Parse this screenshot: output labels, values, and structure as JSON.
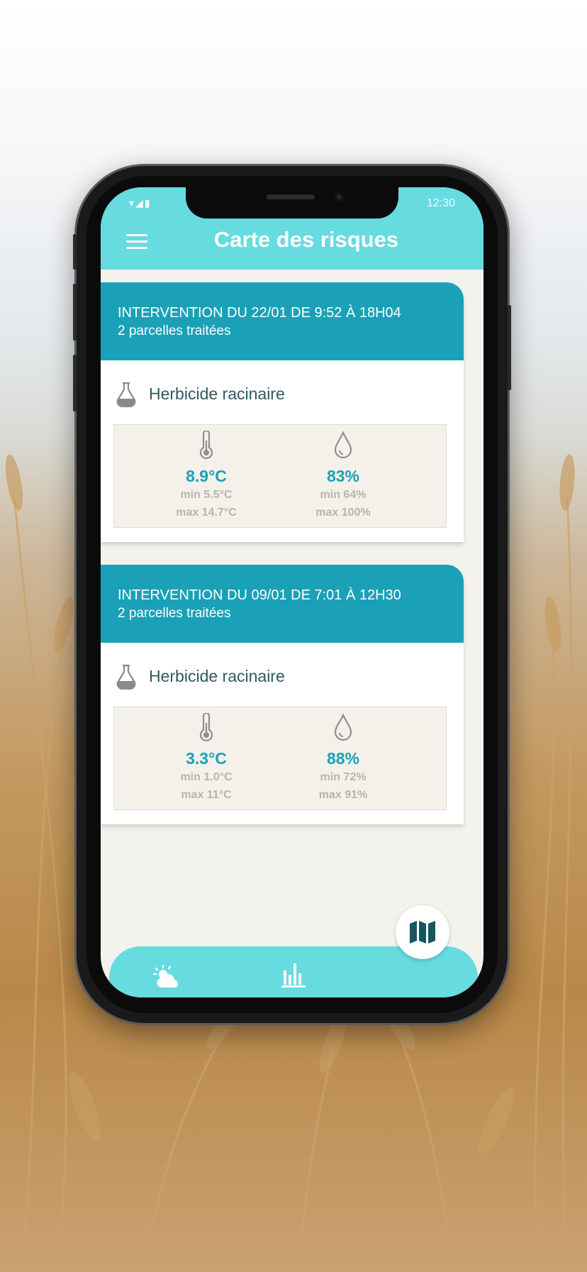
{
  "status_bar": {
    "signal": "▾◢▮",
    "time": "12:30"
  },
  "header": {
    "title": "Carte des risques"
  },
  "interventions": [
    {
      "title": "INTERVENTION DU 22/01 DE 9:52 À 18H04",
      "subtitle": "2 parcelles traitées",
      "product": "Herbicide racinaire",
      "temperature": {
        "value": "8.9°C",
        "min": "min 5.5°C",
        "max": "max 14.7°C"
      },
      "humidity": {
        "value": "83%",
        "min": "min 64%",
        "max": "max 100%"
      }
    },
    {
      "title": "INTERVENTION DU 09/01 DE 7:01 À 12H30",
      "subtitle": "2 parcelles traitées",
      "product": "Herbicide racinaire",
      "temperature": {
        "value": "3.3°C",
        "min": "min 1.0°C",
        "max": "max 11°C"
      },
      "humidity": {
        "value": "88%",
        "min": "min 72%",
        "max": "max 91%"
      }
    }
  ],
  "bottom_nav": {
    "items": [
      {
        "icon": "weather-icon",
        "active": false
      },
      {
        "icon": "chart-icon",
        "active": false
      },
      {
        "icon": "map-icon",
        "active": true
      }
    ]
  },
  "colors": {
    "header": "#66dbe0",
    "card_header": "#1aa1b8",
    "accent": "#1aa1b8",
    "background": "#f4f2ec"
  }
}
